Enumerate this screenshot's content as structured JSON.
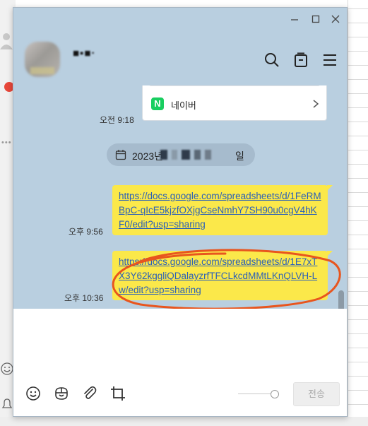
{
  "chat": {
    "name": "■▪■·",
    "link_card": {
      "service_name": "네이버",
      "logo_letter": "N"
    },
    "card_time": "오전 9:18",
    "date_divider": {
      "prefix": "2023년",
      "suffix": "일"
    },
    "messages": [
      {
        "time": "오후 9:56",
        "text": "https://docs.google.com/spreadsheets/d/1FeRMBpC-qIcE5kjzfOXjgCseNmhY7SH90u0cgV4hKF0/edit?usp=sharing"
      },
      {
        "time": "오후 10:36",
        "text": "https://docs.google.com/spreadsheets/d/1E7xTX3Y62kggliQDalayzrfTFCLkcdMMtLKnQLVH-Lw/edit?usp=sharing"
      }
    ]
  },
  "input": {
    "value": "",
    "send_label": "전송"
  },
  "colors": {
    "chat_bg": "#b9cfe0",
    "bubble": "#fbe84a",
    "link": "#2b60b8",
    "annotation": "#e8551e",
    "naver": "#19ce60"
  }
}
